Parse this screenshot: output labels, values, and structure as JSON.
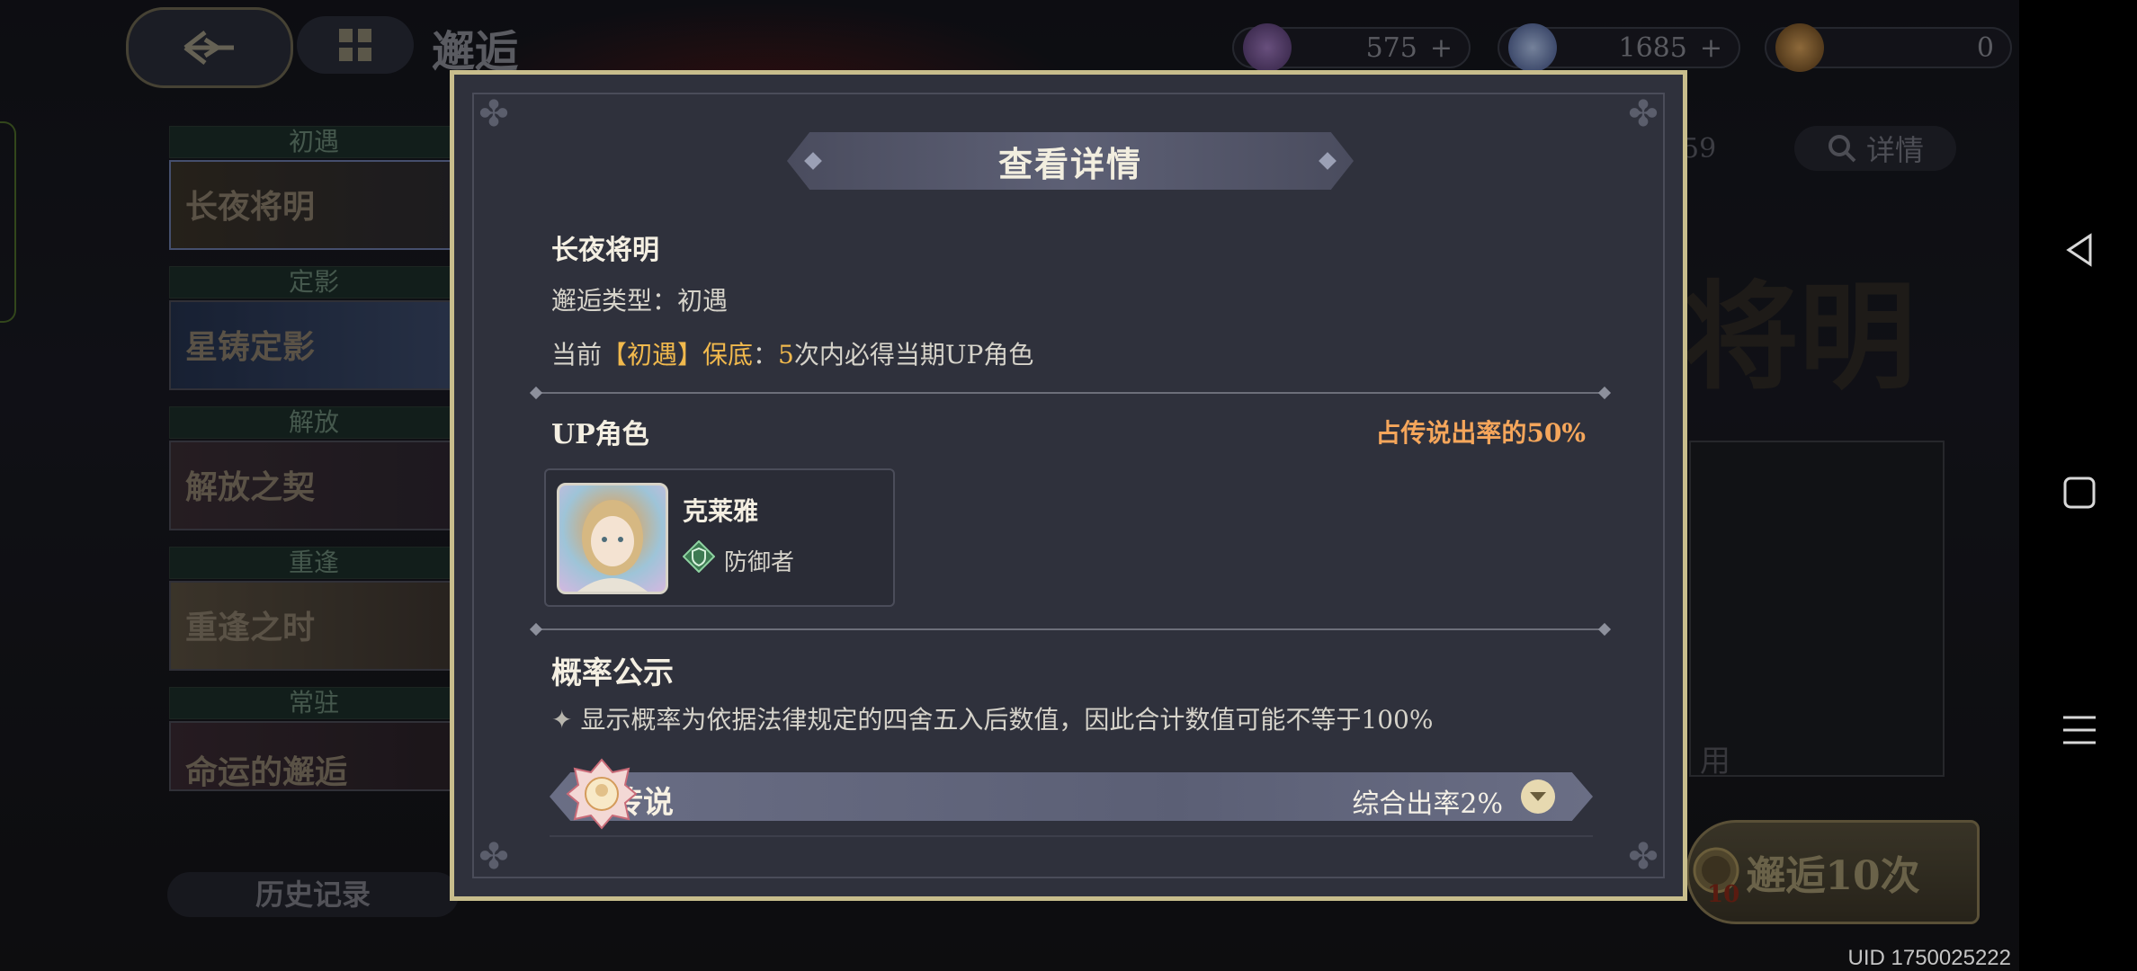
{
  "page": {
    "title": "邂逅",
    "uid": "UID 1750025222"
  },
  "resources": [
    {
      "name": "star-currency",
      "value": "575",
      "color": "#6b4f8a"
    },
    {
      "name": "orb-currency",
      "value": "1685",
      "color": "#5a7bbd"
    },
    {
      "name": "ticket-currency",
      "value": "0",
      "color": "#b07a3a"
    }
  ],
  "sidebar": {
    "banners": [
      {
        "header": "初遇",
        "label": "长夜将明"
      },
      {
        "header": "定影",
        "label": "星铸定影"
      },
      {
        "header": "解放",
        "label": "解放之契"
      },
      {
        "header": "重逢",
        "label": "重逢之时"
      },
      {
        "header": "常驻",
        "label": "命运的邂逅"
      }
    ],
    "history_label": "历史记录"
  },
  "background": {
    "detail_label": "详情",
    "number_fragment": "59",
    "big_title": "将明",
    "gacha_button": "邂逅10次",
    "gacha_count": "10",
    "side_fragment": "用"
  },
  "modal": {
    "title": "查看详情",
    "banner_name": "长夜将明",
    "type_label": "邂逅类型：",
    "type_value": "初遇",
    "pity_prefix": "当前",
    "pity_highlight": "【初遇】保底",
    "pity_colon": "：",
    "pity_count": "5",
    "pity_suffix": "次内必得当期UP角色",
    "up_section_label": "UP角色",
    "up_rate": "占传说出率的50%",
    "character": {
      "name": "克莱雅",
      "role": "防御者"
    },
    "prob_title": "概率公示",
    "prob_note": "显示概率为依据法律规定的四舍五入后数值，因此合计数值可能不等于100%",
    "rarity": {
      "name": "传说",
      "rate": "综合出率2%"
    }
  },
  "colors": {
    "gold_border": "#c8bd8c",
    "highlight": "#f1b94d",
    "up_rate": "#f5a65b",
    "modal_bg": "#2f313c"
  }
}
